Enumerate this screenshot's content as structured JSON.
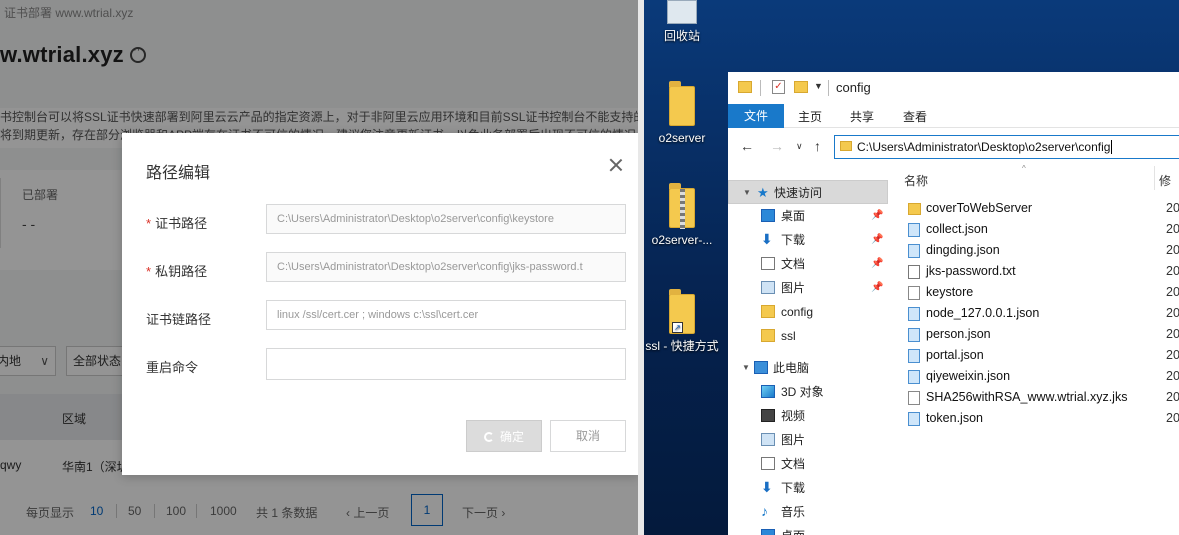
{
  "console": {
    "breadcrumb": "证书部署 www.wtrial.xyz",
    "title": "w.wtrial.xyz",
    "notice_line1": "书控制台可以将SSL证书快速部署到阿里云云产品的指定资源上，对于非阿里云应用环境和目前SSL证书控制台不能支持的应",
    "notice_line2": "将到期更新，存在部分浏览器和APP端存在证书不可信的情况，建议您注意更新证书，以免业务部署后出现不可信的情况",
    "stat_label": "已部署",
    "stat_value": "- -",
    "filter_region": "内地",
    "filter_status": "全部状态",
    "table_header_region": "区域",
    "row_cell_a": "qwy",
    "row_cell_b": "华南1（深圳",
    "pager": {
      "per_page_label": "每页显示",
      "sizes": [
        "10",
        "50",
        "100",
        "1000"
      ],
      "total": "共 1 条数据",
      "prev": "上一页",
      "current": "1",
      "next": "下一页"
    }
  },
  "modal": {
    "title": "路径编辑",
    "fields": [
      {
        "label": "证书路径",
        "required": true,
        "value": "C:\\Users\\Administrator\\Desktop\\o2server\\config\\keystore"
      },
      {
        "label": "私钥路径",
        "required": true,
        "value": "C:\\Users\\Administrator\\Desktop\\o2server\\config\\jks-password.t"
      },
      {
        "label": "证书链路径",
        "required": false,
        "placeholder": "linux /ssl/cert.cer ; windows c:\\ssl\\cert.cer"
      },
      {
        "label": "重启命令",
        "required": false,
        "value": ""
      }
    ],
    "ok_label": "确定",
    "cancel_label": "取消",
    "required_mark": "*"
  },
  "desktop": {
    "icons": [
      {
        "label": "回收站",
        "kind": "recycle-bin"
      },
      {
        "label": "o2server",
        "kind": "folder"
      },
      {
        "label": "o2server-...",
        "kind": "zip-folder"
      },
      {
        "label": "ssl - 快捷方式",
        "kind": "shortcut-folder"
      }
    ]
  },
  "explorer": {
    "window_title": "config",
    "ribbon_tabs": [
      "文件",
      "主页",
      "共享",
      "查看"
    ],
    "address": "C:\\Users\\Administrator\\Desktop\\o2server\\config",
    "nav_items": [
      {
        "label": "快速访问",
        "icon": "star-icon",
        "pinned": false,
        "selected": true
      },
      {
        "label": "桌面",
        "icon": "desktop-icon",
        "pinned": true
      },
      {
        "label": "下载",
        "icon": "download-icon",
        "pinned": true
      },
      {
        "label": "文档",
        "icon": "document-icon",
        "pinned": true
      },
      {
        "label": "图片",
        "icon": "picture-icon",
        "pinned": true
      },
      {
        "label": "config",
        "icon": "folder-icon",
        "pinned": false
      },
      {
        "label": "ssl",
        "icon": "folder-icon",
        "pinned": false
      },
      {
        "label": "此电脑",
        "icon": "pc-icon",
        "pinned": false
      },
      {
        "label": "3D 对象",
        "icon": "3d-icon",
        "pinned": false
      },
      {
        "label": "视频",
        "icon": "video-icon",
        "pinned": false
      },
      {
        "label": "图片",
        "icon": "picture-icon",
        "pinned": false
      },
      {
        "label": "文档",
        "icon": "document-icon",
        "pinned": false
      },
      {
        "label": "下载",
        "icon": "download-icon",
        "pinned": false
      },
      {
        "label": "音乐",
        "icon": "music-icon",
        "pinned": false
      },
      {
        "label": "桌面",
        "icon": "desktop-icon",
        "pinned": false
      }
    ],
    "column_name": "名称",
    "column_modified": "修",
    "files": [
      {
        "name": "coverToWebServer",
        "type": "folder",
        "date": "20"
      },
      {
        "name": "collect.json",
        "type": "json",
        "date": "20"
      },
      {
        "name": "dingding.json",
        "type": "json",
        "date": "20"
      },
      {
        "name": "jks-password.txt",
        "type": "txt",
        "date": "20"
      },
      {
        "name": "keystore",
        "type": "blank",
        "date": "20"
      },
      {
        "name": "node_127.0.0.1.json",
        "type": "json",
        "date": "20"
      },
      {
        "name": "person.json",
        "type": "json",
        "date": "20"
      },
      {
        "name": "portal.json",
        "type": "json",
        "date": "20"
      },
      {
        "name": "qiyeweixin.json",
        "type": "json",
        "date": "20"
      },
      {
        "name": "SHA256withRSA_www.wtrial.xyz.jks",
        "type": "blank",
        "date": "20"
      },
      {
        "name": "token.json",
        "type": "json",
        "date": "20"
      }
    ]
  },
  "colors": {
    "accent": "#0064c8",
    "win_blue": "#1979ca",
    "required": "#d93026",
    "folder": "#f4c94e"
  }
}
